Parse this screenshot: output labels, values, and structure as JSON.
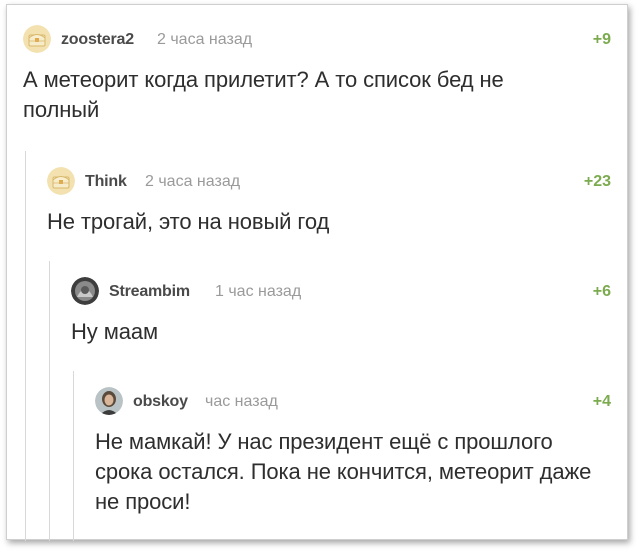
{
  "comments": [
    {
      "username": "zoostera2",
      "time": "2 часа назад",
      "rating": "+9",
      "text": "А метеорит когда прилетит? А то список бед не полный",
      "avatar_icon": "default-chest-avatar-icon"
    },
    {
      "username": "Think",
      "time": "2 часа назад",
      "rating": "+23",
      "text": "Не трогай, это на новый год",
      "avatar_icon": "default-chest-avatar-icon"
    },
    {
      "username": "Streambim",
      "time": "1 час назад",
      "rating": "+6",
      "text": "Ну маам",
      "avatar_icon": "photo-avatar-icon"
    },
    {
      "username": "obskoy",
      "time": "час назад",
      "rating": "+4",
      "text": "Не мамкай! У нас президент ещё с прошлого срока остался. Пока не кончится, метеорит даже не проси!",
      "avatar_icon": "photo-avatar-icon"
    }
  ],
  "colors": {
    "rating": "#7cab4f",
    "username": "#4a4a4a",
    "time": "#9a9a9a",
    "text": "#2e2e2e",
    "thread_line": "#d8d8d8"
  }
}
